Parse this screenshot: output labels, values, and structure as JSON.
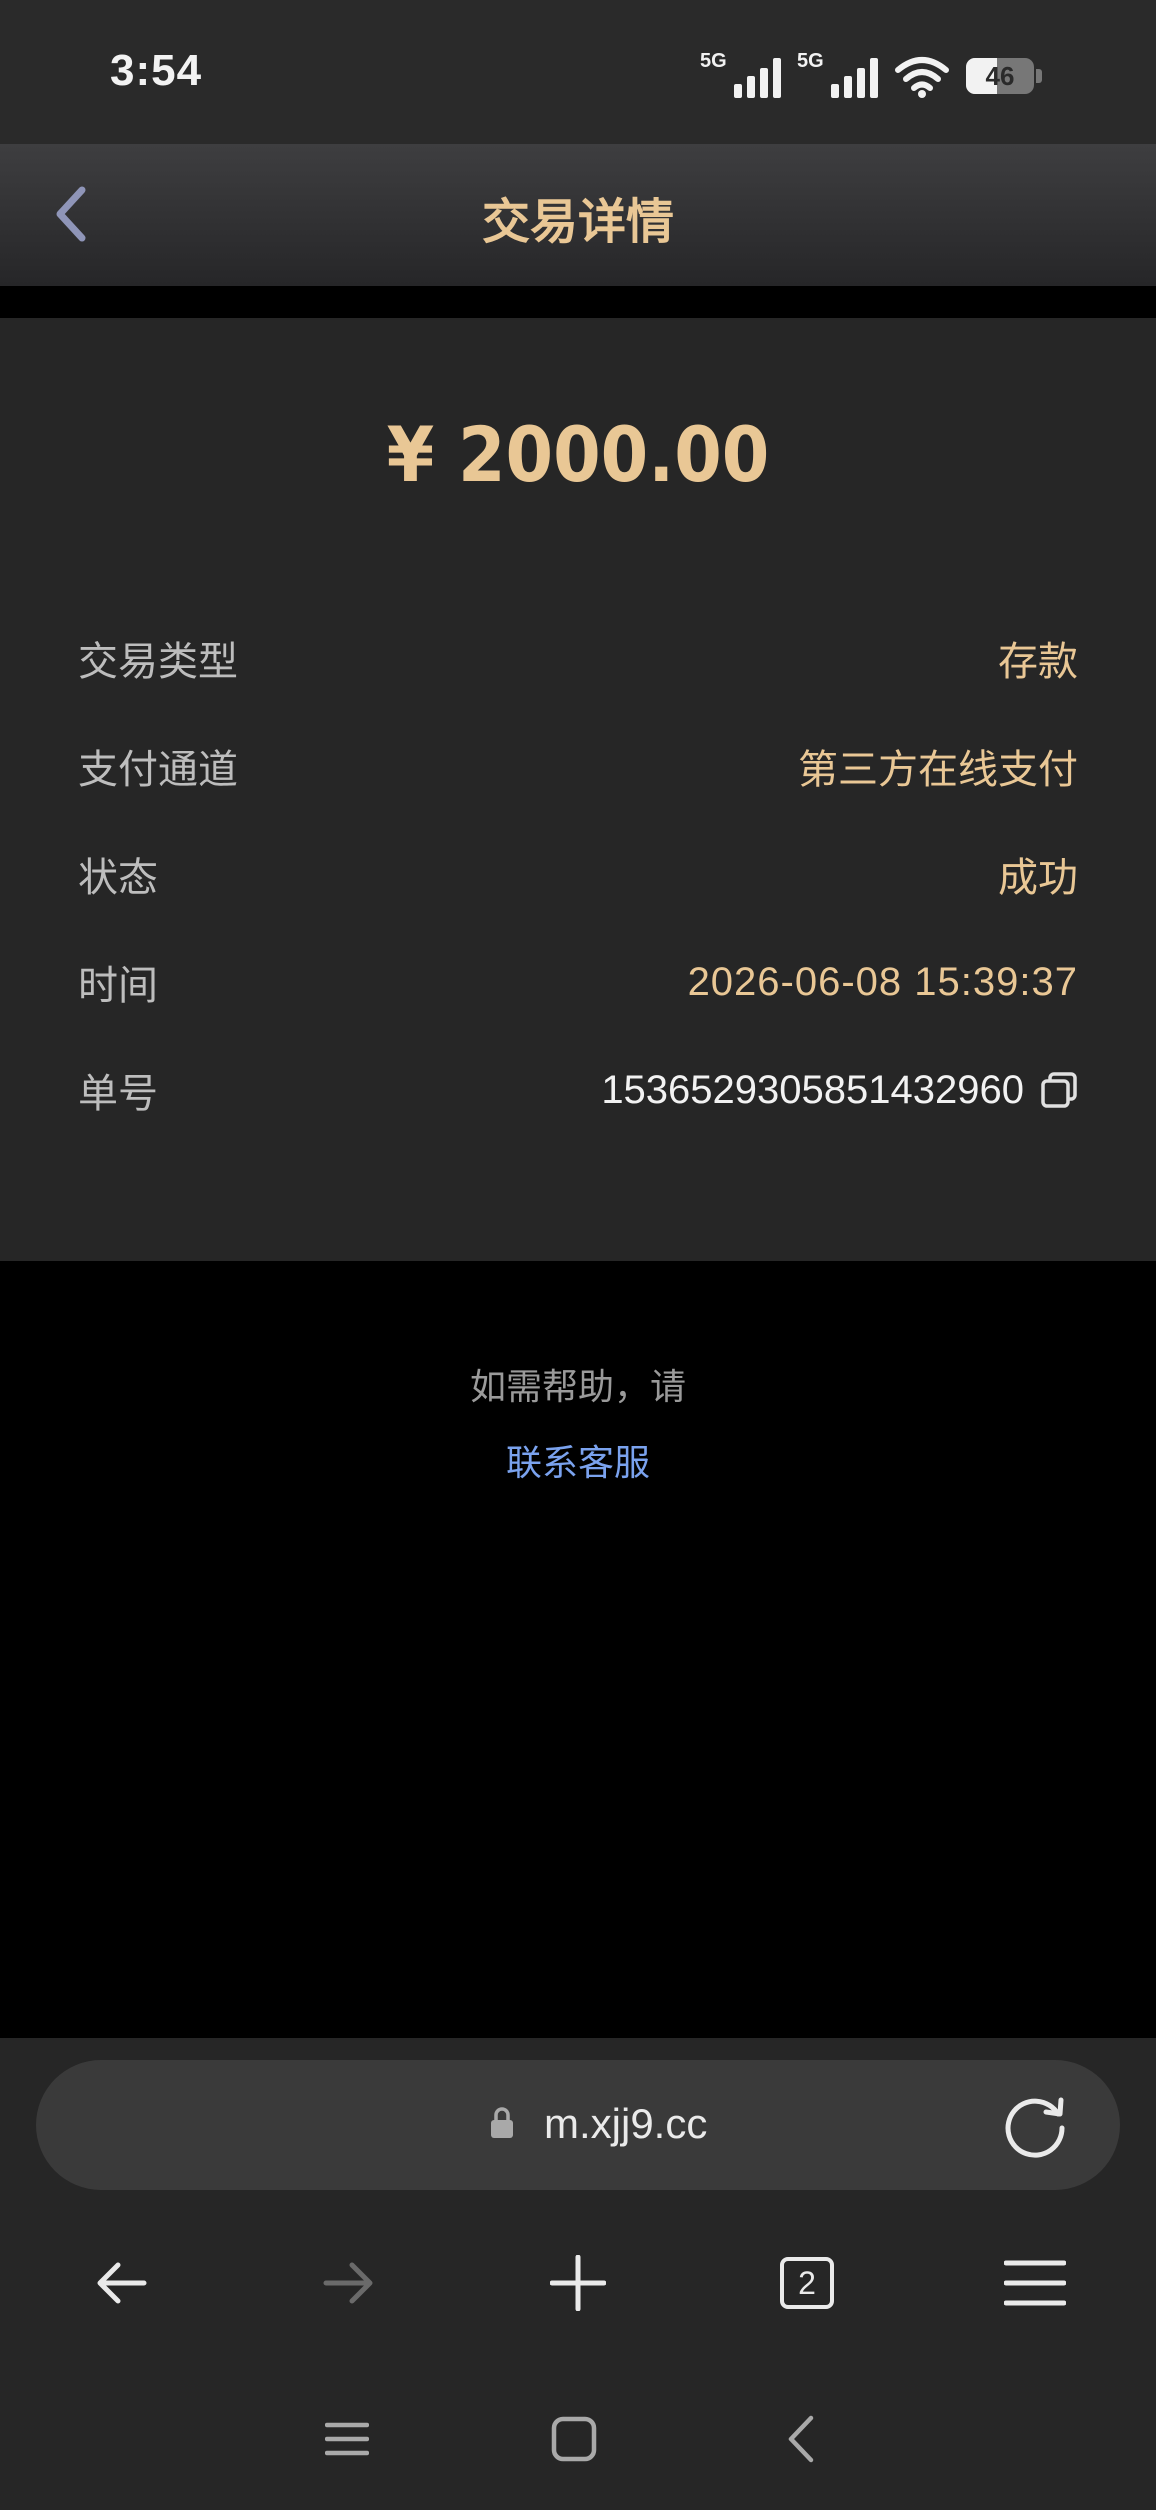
{
  "status_bar": {
    "time": "3:54",
    "network_1": "5G",
    "network_2": "5G",
    "battery_level": "46",
    "battery_fraction": 0.46
  },
  "header": {
    "title": "交易详情",
    "back_icon": "chevron-left-icon"
  },
  "transaction": {
    "amount": "¥ 2000.00",
    "rows": [
      {
        "label": "交易类型",
        "value": "存款"
      },
      {
        "label": "支付通道",
        "value": "第三方在线支付"
      },
      {
        "label": "状态",
        "value": "成功"
      },
      {
        "label": "时间",
        "value": "2026-06-08 15:39:37"
      },
      {
        "label": "单号",
        "value": "1536529305851432960"
      }
    ]
  },
  "help": {
    "text": "如需帮助，请",
    "link": "联系客服"
  },
  "browser": {
    "url": "m.xjj9.cc",
    "tab_count": "2"
  },
  "colors": {
    "accent_gold": "#e9c795",
    "link_blue": "#7aa2ee",
    "card_bg": "#262626",
    "page_bg": "#000000"
  }
}
